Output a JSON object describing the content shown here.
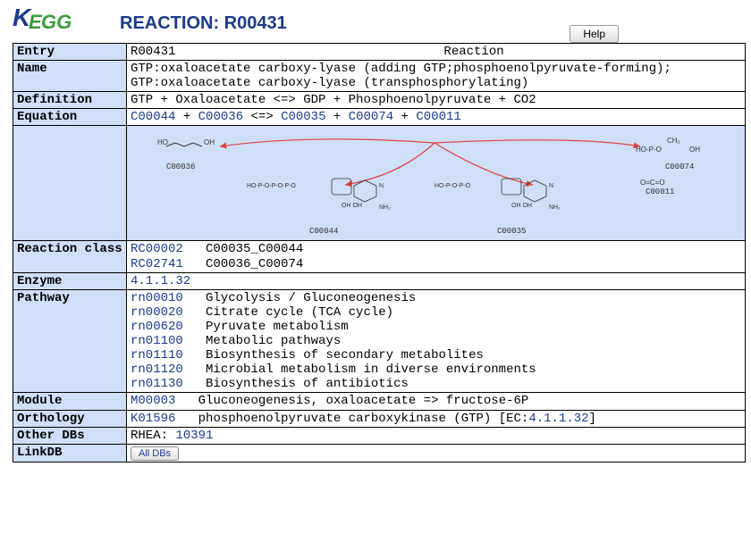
{
  "header": {
    "logo_k": "K",
    "logo_e": "E",
    "logo_gg": "GG",
    "title": "REACTION: R00431",
    "help_label": "Help"
  },
  "entry": {
    "label": "Entry",
    "id": "R00431",
    "type": "Reaction"
  },
  "name": {
    "label": "Name",
    "value": "GTP:oxaloacetate carboxy-lyase (adding GTP;phosphoenolpyruvate-forming);\nGTP:oxaloacetate carboxy-lyase (transphosphorylating)"
  },
  "definition": {
    "label": "Definition",
    "value": "GTP + Oxaloacetate <=> GDP + Phosphoenolpyruvate + CO2"
  },
  "equation": {
    "label": "Equation",
    "c1": "C00044",
    "plus1": " + ",
    "c2": "C00036",
    "eq": " <=> ",
    "c3": "C00035",
    "plus2": " + ",
    "c4": "C00074",
    "plus3": " + ",
    "c5": "C00011"
  },
  "diagram": {
    "c00036": "C00036",
    "c00044": "C00044",
    "c00035": "C00035",
    "c00074": "C00074",
    "c00011": "C00011"
  },
  "reaction_class": {
    "label": "Reaction class",
    "rows": [
      {
        "id": "RC00002",
        "pair": "C00035_C00044"
      },
      {
        "id": "RC02741",
        "pair": "C00036_C00074"
      }
    ]
  },
  "enzyme": {
    "label": "Enzyme",
    "ec": "4.1.1.32"
  },
  "pathway": {
    "label": "Pathway",
    "rows": [
      {
        "id": "rn00010",
        "name": "Glycolysis / Gluconeogenesis"
      },
      {
        "id": "rn00020",
        "name": "Citrate cycle (TCA cycle)"
      },
      {
        "id": "rn00620",
        "name": "Pyruvate metabolism"
      },
      {
        "id": "rn01100",
        "name": "Metabolic pathways"
      },
      {
        "id": "rn01110",
        "name": "Biosynthesis of secondary metabolites"
      },
      {
        "id": "rn01120",
        "name": "Microbial metabolism in diverse environments"
      },
      {
        "id": "rn01130",
        "name": "Biosynthesis of antibiotics"
      }
    ]
  },
  "module": {
    "label": "Module",
    "id": "M00003",
    "name": "Gluconeogenesis, oxaloacetate => fructose-6P"
  },
  "orthology": {
    "label": "Orthology",
    "id": "K01596",
    "name": "phosphoenolpyruvate carboxykinase (GTP) [EC:",
    "ec": "4.1.1.32",
    "suffix": "]"
  },
  "other_dbs": {
    "label": "Other DBs",
    "db": "RHEA: ",
    "id": "10391"
  },
  "linkdb": {
    "label": "LinkDB",
    "button": "All DBs"
  }
}
